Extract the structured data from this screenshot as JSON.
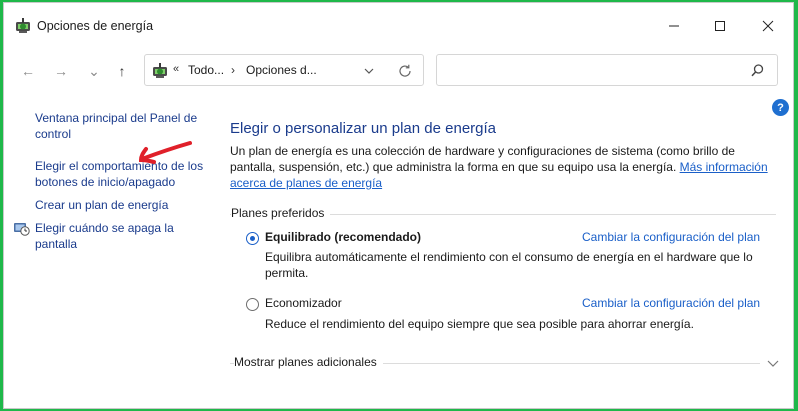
{
  "window": {
    "title": "Opciones de energía",
    "controls": {
      "minimize": "minimize-icon",
      "maximize": "maximize-icon",
      "close": "close-icon"
    }
  },
  "nav": {
    "back_icon": "←",
    "forward_icon": "→",
    "recent_icon": "⌄",
    "up_icon": "↑",
    "address": {
      "sep1": "«",
      "crumb1": "Todo...",
      "sep2": "›",
      "crumb2": "Opciones d..."
    },
    "search_placeholder": ""
  },
  "help": {
    "label": "?"
  },
  "sidebar": {
    "items": [
      {
        "label": "Ventana principal del Panel de control"
      },
      {
        "label": "Elegir el comportamiento de los botones de inicio/apagado"
      },
      {
        "label": "Crear un plan de energía"
      },
      {
        "label": "Elegir cuándo se apaga la pantalla"
      }
    ]
  },
  "main": {
    "title": "Elegir o personalizar un plan de energía",
    "description": "Un plan de energía es una colección de hardware y configuraciones de sistema (como brillo de pantalla, suspensión, etc.) que administra la forma en que su equipo usa la energía.",
    "more_info_link": "Más información acerca de planes de energía",
    "preferred_label": "Planes preferidos",
    "plans": [
      {
        "name": "Equilibrado (recomendado)",
        "selected": true,
        "link": "Cambiar la configuración del plan",
        "description": "Equilibra automáticamente el rendimiento con el consumo de energía en el hardware que lo permita."
      },
      {
        "name": "Economizador",
        "selected": false,
        "link": "Cambiar la configuración del plan",
        "description": "Reduce el rendimiento del equipo siempre que sea posible para ahorrar energía."
      }
    ],
    "more_plans_label": "Mostrar planes adicionales"
  },
  "colors": {
    "link": "#1a5fc8",
    "nav_link": "#1a3b8c",
    "annotation": "#e0202a",
    "background": "#1fb84a"
  }
}
